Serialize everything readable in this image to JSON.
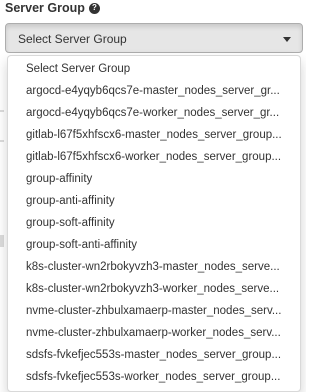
{
  "field": {
    "label": "Server Group",
    "help_icon": "question-circle-icon"
  },
  "select": {
    "selected_value": "Select Server Group",
    "caret_icon": "caret-down-icon"
  },
  "dropdown": {
    "options": [
      "Select Server Group",
      "argocd-e4yqyb6qcs7e-master_nodes_server_gr...",
      "argocd-e4yqyb6qcs7e-worker_nodes_server_gr...",
      "gitlab-l67f5xhfscx6-master_nodes_server_group...",
      "gitlab-l67f5xhfscx6-worker_nodes_server_group...",
      "group-affinity",
      "group-anti-affinity",
      "group-soft-affinity",
      "group-soft-anti-affinity",
      "k8s-cluster-wn2rbokyvzh3-master_nodes_serve...",
      "k8s-cluster-wn2rbokyvzh3-worker_nodes_serve...",
      "nvme-cluster-zhbulxamaerp-master_nodes_serv...",
      "nvme-cluster-zhbulxamaerp-worker_nodes_serv...",
      "sdsfs-fvkefjec553s-master_nodes_server_group...",
      "sdsfs-fvkefjec553s-worker_nodes_server_group..."
    ]
  },
  "colors": {
    "text": "#333333",
    "select_background": "#e6e6e6",
    "select_border": "#adadad"
  }
}
